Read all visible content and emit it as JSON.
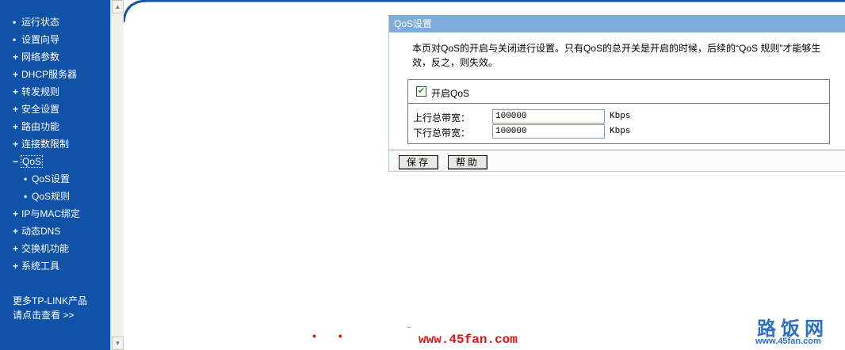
{
  "sidebar": {
    "items": [
      {
        "label": "运行状态",
        "bullet": "•"
      },
      {
        "label": "设置向导",
        "bullet": "•"
      },
      {
        "label": "网络参数",
        "bullet": "+"
      },
      {
        "label": "DHCP服务器",
        "bullet": "+"
      },
      {
        "label": "转发规则",
        "bullet": "+"
      },
      {
        "label": "安全设置",
        "bullet": "+"
      },
      {
        "label": "路由功能",
        "bullet": "+"
      },
      {
        "label": "连接数限制",
        "bullet": "+"
      },
      {
        "label": "QoS",
        "bullet": "−"
      }
    ],
    "sub_items": [
      {
        "label": "QoS设置",
        "bullet": "•"
      },
      {
        "label": "QoS规则",
        "bullet": "•"
      }
    ],
    "items_after": [
      {
        "label": "IP与MAC绑定",
        "bullet": "+"
      },
      {
        "label": "动态DNS",
        "bullet": "+"
      },
      {
        "label": "交换机功能",
        "bullet": "+"
      },
      {
        "label": "系统工具",
        "bullet": "+"
      }
    ],
    "more_line1": "更多TP-LINK产品",
    "more_line2": "请点击查看 >>"
  },
  "scrollbar": {
    "up_icon": "▲",
    "down_icon": "▼"
  },
  "panel": {
    "title": "QoS设置",
    "description": "本页对QoS的开启与关闭进行设置。只有QoS的总开关是开启的时候，后续的“QoS 规则”才能够生效，反之，则失效。",
    "enable_label": "开启QoS",
    "enable_checked": true,
    "check_mark": "✔",
    "upload_label": "上行总带宽：",
    "upload_value": "100000",
    "download_label": "下行总带宽：",
    "download_value": "100000",
    "unit": "Kbps",
    "save_button": "保存",
    "help_button": "帮助"
  },
  "watermark": {
    "dots": "• •",
    "dots2": "¨",
    "url": "www.45fan.com",
    "brand": "路饭网",
    "brand_url": "www.45fan.com"
  },
  "colors": {
    "sidebar_bg": "#0f52a8",
    "panel_header": "#7faddb",
    "accent_line": "#f0a050",
    "watermark_red": "#e81010",
    "brand_blue": "#2e6fbf"
  }
}
